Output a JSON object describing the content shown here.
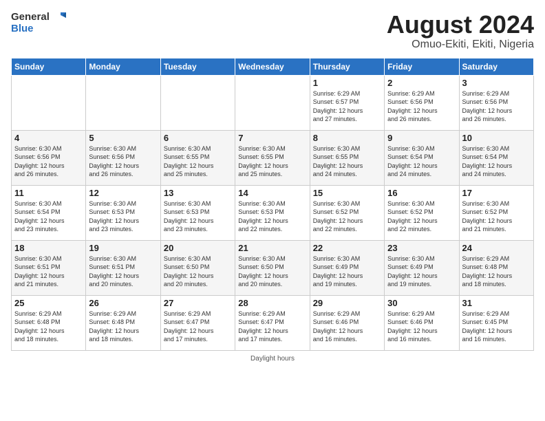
{
  "header": {
    "logo_line1": "General",
    "logo_line2": "Blue",
    "main_title": "August 2024",
    "subtitle": "Omuo-Ekiti, Ekiti, Nigeria"
  },
  "days_of_week": [
    "Sunday",
    "Monday",
    "Tuesday",
    "Wednesday",
    "Thursday",
    "Friday",
    "Saturday"
  ],
  "weeks": [
    [
      {
        "day": "",
        "info": ""
      },
      {
        "day": "",
        "info": ""
      },
      {
        "day": "",
        "info": ""
      },
      {
        "day": "",
        "info": ""
      },
      {
        "day": "1",
        "info": "Sunrise: 6:29 AM\nSunset: 6:57 PM\nDaylight: 12 hours\nand 27 minutes."
      },
      {
        "day": "2",
        "info": "Sunrise: 6:29 AM\nSunset: 6:56 PM\nDaylight: 12 hours\nand 26 minutes."
      },
      {
        "day": "3",
        "info": "Sunrise: 6:29 AM\nSunset: 6:56 PM\nDaylight: 12 hours\nand 26 minutes."
      }
    ],
    [
      {
        "day": "4",
        "info": "Sunrise: 6:30 AM\nSunset: 6:56 PM\nDaylight: 12 hours\nand 26 minutes."
      },
      {
        "day": "5",
        "info": "Sunrise: 6:30 AM\nSunset: 6:56 PM\nDaylight: 12 hours\nand 26 minutes."
      },
      {
        "day": "6",
        "info": "Sunrise: 6:30 AM\nSunset: 6:55 PM\nDaylight: 12 hours\nand 25 minutes."
      },
      {
        "day": "7",
        "info": "Sunrise: 6:30 AM\nSunset: 6:55 PM\nDaylight: 12 hours\nand 25 minutes."
      },
      {
        "day": "8",
        "info": "Sunrise: 6:30 AM\nSunset: 6:55 PM\nDaylight: 12 hours\nand 24 minutes."
      },
      {
        "day": "9",
        "info": "Sunrise: 6:30 AM\nSunset: 6:54 PM\nDaylight: 12 hours\nand 24 minutes."
      },
      {
        "day": "10",
        "info": "Sunrise: 6:30 AM\nSunset: 6:54 PM\nDaylight: 12 hours\nand 24 minutes."
      }
    ],
    [
      {
        "day": "11",
        "info": "Sunrise: 6:30 AM\nSunset: 6:54 PM\nDaylight: 12 hours\nand 23 minutes."
      },
      {
        "day": "12",
        "info": "Sunrise: 6:30 AM\nSunset: 6:53 PM\nDaylight: 12 hours\nand 23 minutes."
      },
      {
        "day": "13",
        "info": "Sunrise: 6:30 AM\nSunset: 6:53 PM\nDaylight: 12 hours\nand 23 minutes."
      },
      {
        "day": "14",
        "info": "Sunrise: 6:30 AM\nSunset: 6:53 PM\nDaylight: 12 hours\nand 22 minutes."
      },
      {
        "day": "15",
        "info": "Sunrise: 6:30 AM\nSunset: 6:52 PM\nDaylight: 12 hours\nand 22 minutes."
      },
      {
        "day": "16",
        "info": "Sunrise: 6:30 AM\nSunset: 6:52 PM\nDaylight: 12 hours\nand 22 minutes."
      },
      {
        "day": "17",
        "info": "Sunrise: 6:30 AM\nSunset: 6:52 PM\nDaylight: 12 hours\nand 21 minutes."
      }
    ],
    [
      {
        "day": "18",
        "info": "Sunrise: 6:30 AM\nSunset: 6:51 PM\nDaylight: 12 hours\nand 21 minutes."
      },
      {
        "day": "19",
        "info": "Sunrise: 6:30 AM\nSunset: 6:51 PM\nDaylight: 12 hours\nand 20 minutes."
      },
      {
        "day": "20",
        "info": "Sunrise: 6:30 AM\nSunset: 6:50 PM\nDaylight: 12 hours\nand 20 minutes."
      },
      {
        "day": "21",
        "info": "Sunrise: 6:30 AM\nSunset: 6:50 PM\nDaylight: 12 hours\nand 20 minutes."
      },
      {
        "day": "22",
        "info": "Sunrise: 6:30 AM\nSunset: 6:49 PM\nDaylight: 12 hours\nand 19 minutes."
      },
      {
        "day": "23",
        "info": "Sunrise: 6:30 AM\nSunset: 6:49 PM\nDaylight: 12 hours\nand 19 minutes."
      },
      {
        "day": "24",
        "info": "Sunrise: 6:29 AM\nSunset: 6:48 PM\nDaylight: 12 hours\nand 18 minutes."
      }
    ],
    [
      {
        "day": "25",
        "info": "Sunrise: 6:29 AM\nSunset: 6:48 PM\nDaylight: 12 hours\nand 18 minutes."
      },
      {
        "day": "26",
        "info": "Sunrise: 6:29 AM\nSunset: 6:48 PM\nDaylight: 12 hours\nand 18 minutes."
      },
      {
        "day": "27",
        "info": "Sunrise: 6:29 AM\nSunset: 6:47 PM\nDaylight: 12 hours\nand 17 minutes."
      },
      {
        "day": "28",
        "info": "Sunrise: 6:29 AM\nSunset: 6:47 PM\nDaylight: 12 hours\nand 17 minutes."
      },
      {
        "day": "29",
        "info": "Sunrise: 6:29 AM\nSunset: 6:46 PM\nDaylight: 12 hours\nand 16 minutes."
      },
      {
        "day": "30",
        "info": "Sunrise: 6:29 AM\nSunset: 6:46 PM\nDaylight: 12 hours\nand 16 minutes."
      },
      {
        "day": "31",
        "info": "Sunrise: 6:29 AM\nSunset: 6:45 PM\nDaylight: 12 hours\nand 16 minutes."
      }
    ]
  ],
  "footer": {
    "daylight_label": "Daylight hours"
  }
}
